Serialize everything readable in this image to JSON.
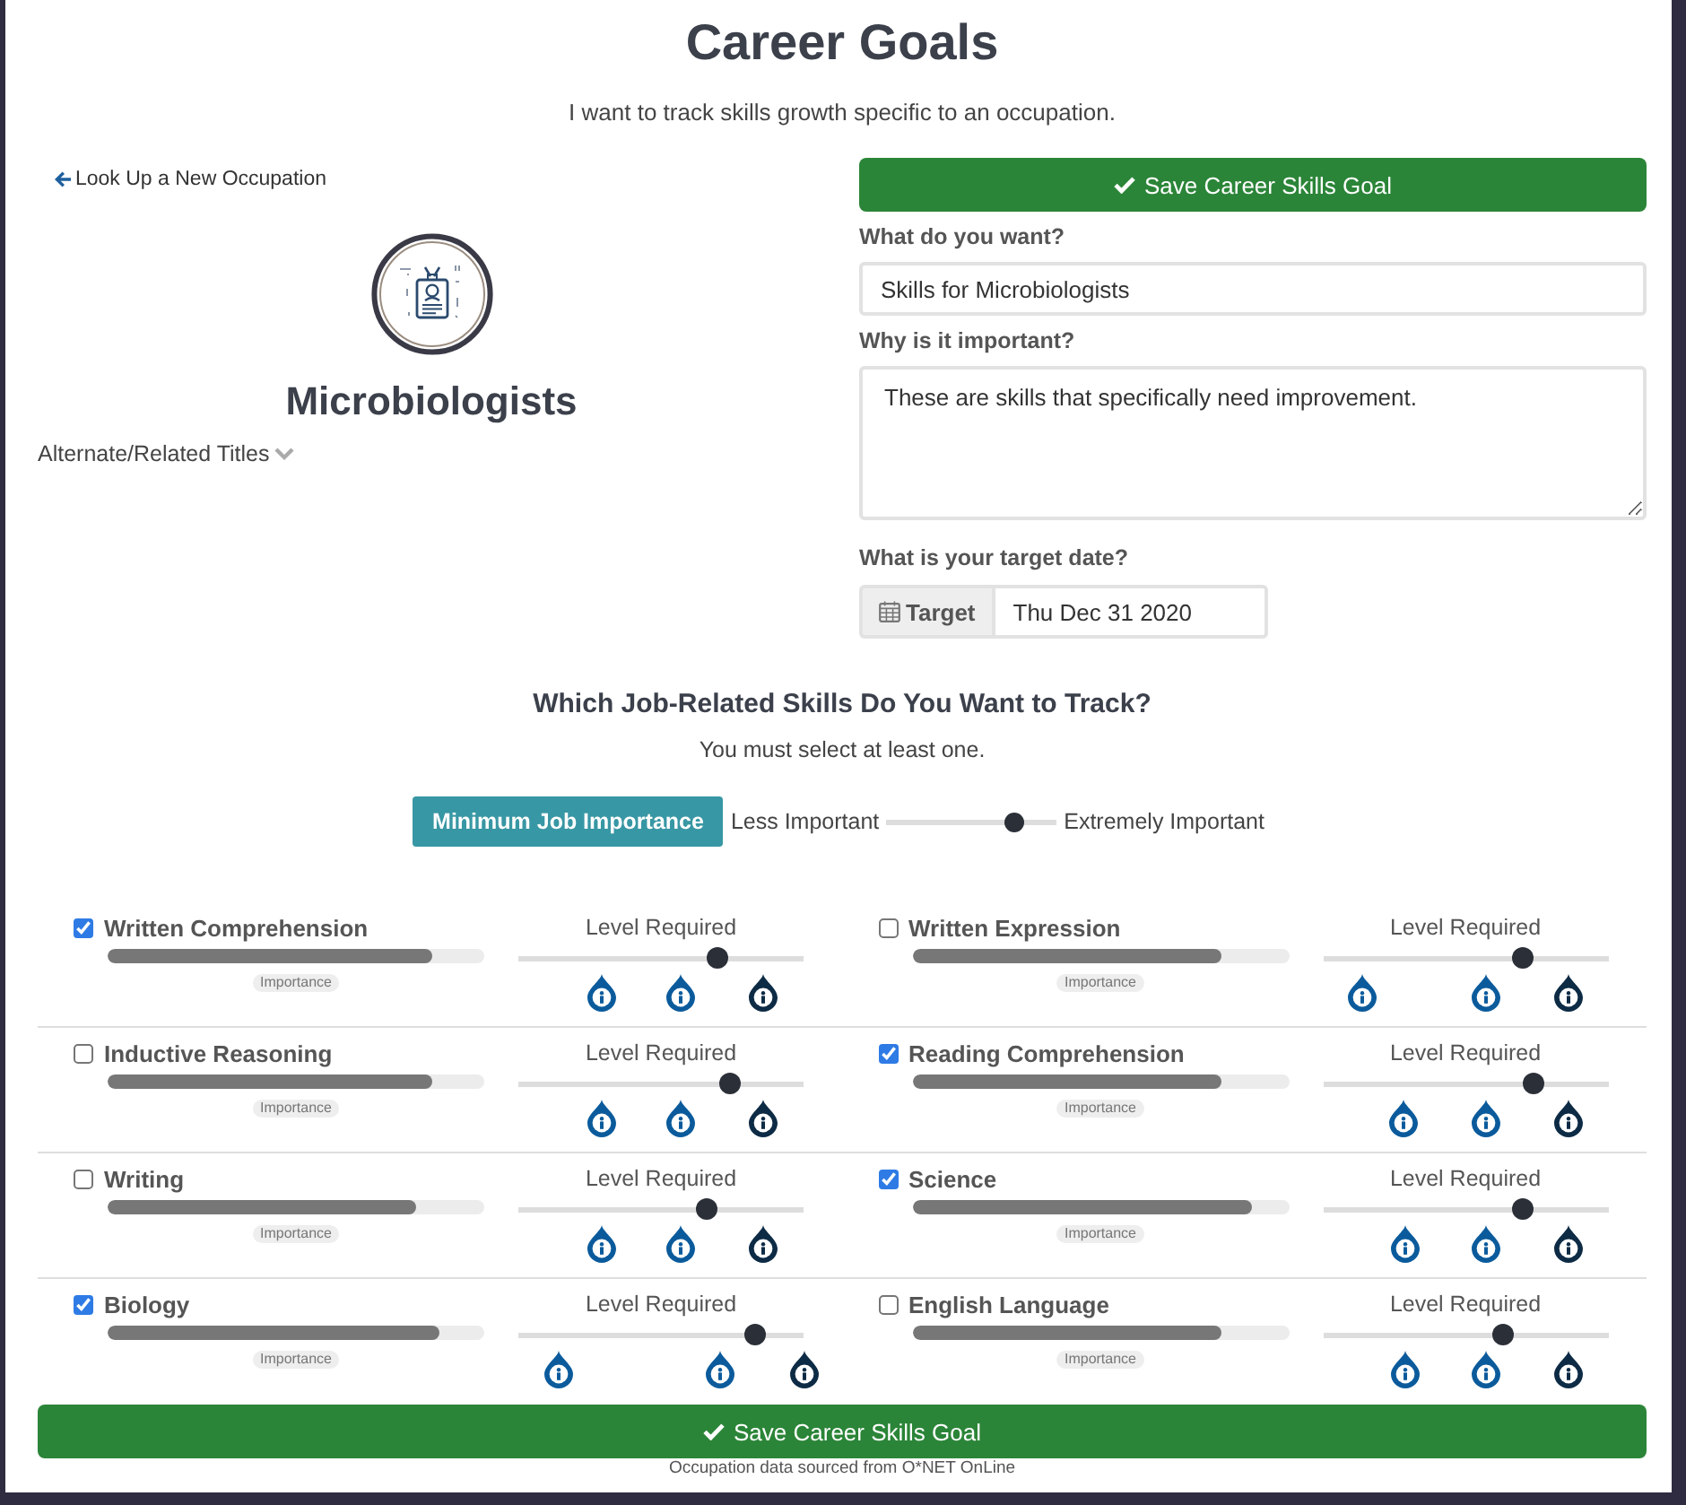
{
  "header": {
    "title": "Career Goals",
    "subtitle": "I want to track skills growth specific to an occupation."
  },
  "occupation": {
    "back_link": "Look Up a New Occupation",
    "name": "Microbiologists",
    "alternate_titles": {
      "label": "Alternate/Related Titles",
      "expanded": false
    }
  },
  "form": {
    "save_button": "Save Career Skills Goal",
    "fields": [
      {
        "kind": "input",
        "label": "What do you want?",
        "value": "Skills for Microbiologists"
      },
      {
        "kind": "textarea",
        "label": "Why is it important?",
        "value": "These are skills that specifically need improvement."
      },
      {
        "kind": "date",
        "label": "What is your target date?",
        "addon": "Target",
        "value": "Thu Dec 31 2020"
      }
    ]
  },
  "skills_section": {
    "heading": "Which Job-Related Skills Do You Want to Track?",
    "note": "You must select at least one.",
    "importance_filter": {
      "label": "Minimum Job Importance",
      "min_label": "Less Important",
      "max_label": "Extremely Important",
      "level": 0.75
    }
  },
  "skills": [
    {
      "name": "Written Comprehension",
      "checked": true,
      "importance": {
        "level": 0.86,
        "tag": "Importance"
      },
      "level_required": {
        "label": "Level Required",
        "level": 0.7,
        "anchors": [
          {
            "level": 0.29,
            "color": "#0b5b9c"
          },
          {
            "level": 0.57,
            "color": "#0b5b9c"
          },
          {
            "level": 0.86,
            "color": "#0d2b45"
          }
        ]
      }
    },
    {
      "name": "Written Expression",
      "checked": false,
      "importance": {
        "level": 0.82,
        "tag": "Importance"
      },
      "level_required": {
        "label": "Level Required",
        "level": 0.7,
        "anchors": [
          {
            "level": 0.14,
            "color": "#0b5b9c"
          },
          {
            "level": 0.57,
            "color": "#0b5b9c"
          },
          {
            "level": 0.86,
            "color": "#0d2b45"
          }
        ]
      }
    },
    {
      "name": "Inductive Reasoning",
      "checked": false,
      "importance": {
        "level": 0.86,
        "tag": "Importance"
      },
      "level_required": {
        "label": "Level Required",
        "level": 0.74,
        "anchors": [
          {
            "level": 0.29,
            "color": "#0b5b9c"
          },
          {
            "level": 0.57,
            "color": "#0b5b9c"
          },
          {
            "level": 0.86,
            "color": "#0d2b45"
          }
        ]
      }
    },
    {
      "name": "Reading Comprehension",
      "checked": true,
      "importance": {
        "level": 0.82,
        "tag": "Importance"
      },
      "level_required": {
        "label": "Level Required",
        "level": 0.74,
        "anchors": [
          {
            "level": 0.28,
            "color": "#0b5b9c"
          },
          {
            "level": 0.57,
            "color": "#0b5b9c"
          },
          {
            "level": 0.86,
            "color": "#0d2b45"
          }
        ]
      }
    },
    {
      "name": "Writing",
      "checked": false,
      "importance": {
        "level": 0.82,
        "tag": "Importance"
      },
      "level_required": {
        "label": "Level Required",
        "level": 0.66,
        "anchors": [
          {
            "level": 0.29,
            "color": "#0b5b9c"
          },
          {
            "level": 0.57,
            "color": "#0b5b9c"
          },
          {
            "level": 0.86,
            "color": "#0d2b45"
          }
        ]
      }
    },
    {
      "name": "Science",
      "checked": true,
      "importance": {
        "level": 0.9,
        "tag": "Importance"
      },
      "level_required": {
        "label": "Level Required",
        "level": 0.7,
        "anchors": [
          {
            "level": 0.29,
            "color": "#0b5b9c"
          },
          {
            "level": 0.57,
            "color": "#0b5b9c"
          },
          {
            "level": 0.86,
            "color": "#0d2b45"
          }
        ]
      }
    },
    {
      "name": "Biology",
      "checked": true,
      "importance": {
        "level": 0.88,
        "tag": "Importance"
      },
      "level_required": {
        "label": "Level Required",
        "level": 0.83,
        "anchors": [
          {
            "level": 0.14,
            "color": "#0b5b9c"
          },
          {
            "level": 0.71,
            "color": "#0b5b9c"
          },
          {
            "level": 1.0,
            "color": "#0d2b45"
          }
        ]
      }
    },
    {
      "name": "English Language",
      "checked": false,
      "importance": {
        "level": 0.82,
        "tag": "Importance"
      },
      "level_required": {
        "label": "Level Required",
        "level": 0.63,
        "anchors": [
          {
            "level": 0.29,
            "color": "#0b5b9c"
          },
          {
            "level": 0.57,
            "color": "#0b5b9c"
          },
          {
            "level": 0.86,
            "color": "#0d2b45"
          }
        ]
      }
    }
  ],
  "footer": {
    "save_button": "Save Career Skills Goal",
    "source": "Occupation data sourced from O*NET OnLine"
  }
}
